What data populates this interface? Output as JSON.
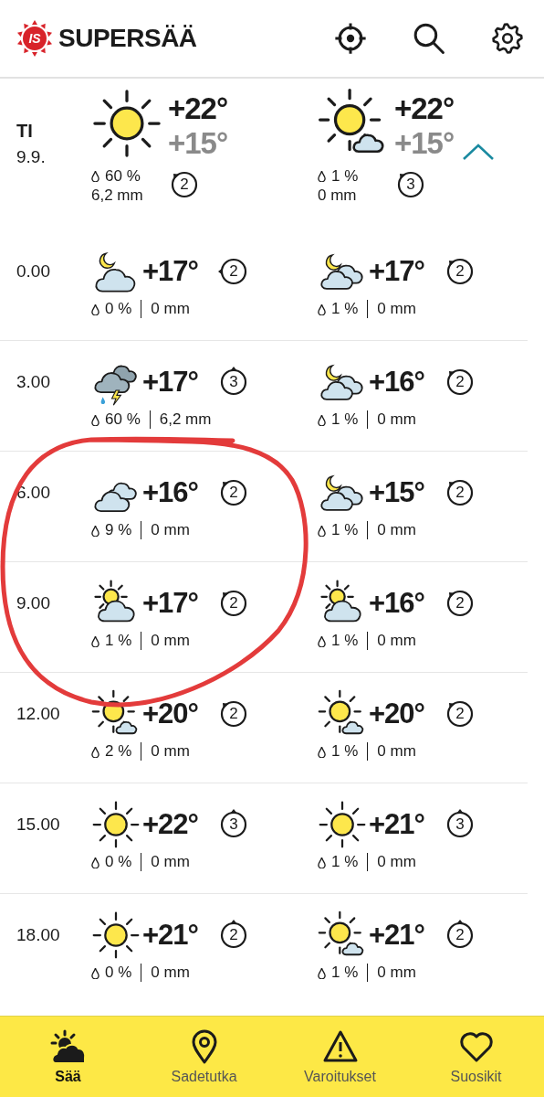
{
  "app": {
    "logo": "IS",
    "title": "SUPERSÄÄ"
  },
  "day": {
    "weekday": "TI",
    "date": "9.9.",
    "expanded": true,
    "columns": [
      {
        "kind": "sun",
        "high": "+22°",
        "low": "+15°",
        "chance": "60 %",
        "amount": "6,2 mm",
        "wind": "2"
      },
      {
        "kind": "sun_cloud",
        "high": "+22°",
        "low": "+15°",
        "chance": "1 %",
        "amount": "0 mm",
        "wind": "3"
      }
    ]
  },
  "hours": [
    {
      "time": "0.00",
      "columns": [
        {
          "kind": "moon_cloud",
          "temp": "+17°",
          "chance": "0 %",
          "amount": "0 mm",
          "wind": "2"
        },
        {
          "kind": "moon_clouds",
          "temp": "+17°",
          "chance": "1 %",
          "amount": "0 mm",
          "wind": "2"
        }
      ]
    },
    {
      "time": "3.00",
      "columns": [
        {
          "kind": "thunder",
          "temp": "+17°",
          "chance": "60 %",
          "amount": "6,2 mm",
          "wind": "3"
        },
        {
          "kind": "moon_clouds",
          "temp": "+16°",
          "chance": "1 %",
          "amount": "0 mm",
          "wind": "2"
        }
      ]
    },
    {
      "time": "6.00",
      "columns": [
        {
          "kind": "cloud",
          "temp": "+16°",
          "chance": "9 %",
          "amount": "0 mm",
          "wind": "2"
        },
        {
          "kind": "moon_clouds",
          "temp": "+15°",
          "chance": "1 %",
          "amount": "0 mm",
          "wind": "2"
        }
      ]
    },
    {
      "time": "9.00",
      "columns": [
        {
          "kind": "cloud_sun",
          "temp": "+17°",
          "chance": "1 %",
          "amount": "0 mm",
          "wind": "2"
        },
        {
          "kind": "cloud_sun",
          "temp": "+16°",
          "chance": "1 %",
          "amount": "0 mm",
          "wind": "2"
        }
      ]
    },
    {
      "time": "12.00",
      "columns": [
        {
          "kind": "sun_cloud",
          "temp": "+20°",
          "chance": "2 %",
          "amount": "0 mm",
          "wind": "2"
        },
        {
          "kind": "sun_cloud",
          "temp": "+20°",
          "chance": "1 %",
          "amount": "0 mm",
          "wind": "2"
        }
      ]
    },
    {
      "time": "15.00",
      "columns": [
        {
          "kind": "sun",
          "temp": "+22°",
          "chance": "0 %",
          "amount": "0 mm",
          "wind": "3"
        },
        {
          "kind": "sun",
          "temp": "+21°",
          "chance": "1 %",
          "amount": "0 mm",
          "wind": "3"
        }
      ]
    },
    {
      "time": "18.00",
      "columns": [
        {
          "kind": "sun",
          "temp": "+21°",
          "chance": "0 %",
          "amount": "0 mm",
          "wind": "2"
        },
        {
          "kind": "sun_cloud",
          "temp": "+21°",
          "chance": "1 %",
          "amount": "0 mm",
          "wind": "2"
        }
      ]
    }
  ],
  "nav": [
    {
      "label": "Sää",
      "selected": true
    },
    {
      "label": "Sadetutka",
      "selected": false
    },
    {
      "label": "Varoitukset",
      "selected": false
    },
    {
      "label": "Suosikit",
      "selected": false
    }
  ],
  "annotation": {
    "kind": "circle"
  }
}
